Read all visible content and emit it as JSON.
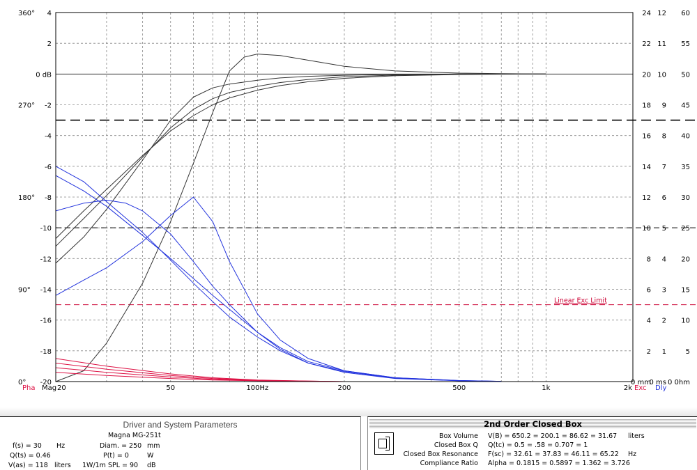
{
  "chart_data": {
    "type": "line",
    "xscale": "log",
    "xlim": [
      20,
      2000
    ],
    "ylim": [
      -20,
      4
    ],
    "x_ticks": [
      {
        "v": 20,
        "label": "20"
      },
      {
        "v": 50,
        "label": "50"
      },
      {
        "v": 100,
        "label": "100Hz"
      },
      {
        "v": 200,
        "label": "200"
      },
      {
        "v": 500,
        "label": "500"
      },
      {
        "v": 1000,
        "label": "1k"
      },
      {
        "v": 2000,
        "label": "2k"
      }
    ],
    "mag_ticks": [
      {
        "v": 4,
        "label": "4"
      },
      {
        "v": 2,
        "label": "2"
      },
      {
        "v": 0,
        "label": "0 dB"
      },
      {
        "v": -2,
        "label": "-2"
      },
      {
        "v": -4,
        "label": "-4"
      },
      {
        "v": -6,
        "label": "-6"
      },
      {
        "v": -8,
        "label": "-8"
      },
      {
        "v": -10,
        "label": "-10"
      },
      {
        "v": -12,
        "label": "-12"
      },
      {
        "v": -14,
        "label": "-14"
      },
      {
        "v": -16,
        "label": "-16"
      },
      {
        "v": -18,
        "label": "-18"
      },
      {
        "v": -20,
        "label": "-20"
      }
    ],
    "phase_ticks": [
      {
        "v": 4,
        "label": "360°"
      },
      {
        "v": -2,
        "label": "270°"
      },
      {
        "v": -8,
        "label": "180°"
      },
      {
        "v": -14,
        "label": "90°"
      },
      {
        "v": -20,
        "label": "0°"
      }
    ],
    "right_axes": [
      {
        "values": [
          "24",
          "22",
          "20",
          "18",
          "16",
          "14",
          "12",
          "10",
          "8",
          "6",
          "4",
          "2",
          "0 mm"
        ]
      },
      {
        "values": [
          "12",
          "11",
          "10",
          "9",
          "8",
          "7",
          "6",
          "5",
          "4",
          "3",
          "2",
          "1",
          "0 ms"
        ]
      },
      {
        "values": [
          "60",
          "55",
          "50",
          "45",
          "40",
          "35",
          "30",
          "25",
          "20",
          "15",
          "10",
          "5",
          "0 0hm"
        ]
      }
    ],
    "bottom_labels": {
      "pha": "Pha",
      "mag": "Mag",
      "exc": "Exc",
      "dly": "Dly"
    },
    "reference_lines": [
      {
        "y": -3,
        "style": "long-dash",
        "color": "#000000"
      },
      {
        "y": -10,
        "style": "dash",
        "color": "#000000"
      },
      {
        "y": -15,
        "style": "dash",
        "color": "#cc0033",
        "label": "Linear Exc Limit"
      }
    ],
    "series": [
      {
        "group": "magnitude",
        "color": "#333333",
        "x": [
          20,
          25,
          30,
          40,
          50,
          60,
          70,
          80,
          90,
          100,
          120,
          150,
          200,
          300,
          500,
          700,
          1000
        ],
        "y": [
          -21,
          -19.3,
          -17.5,
          -13.6,
          -9.6,
          -5.8,
          -2.5,
          0.2,
          1.1,
          1.3,
          1.2,
          0.9,
          0.5,
          0.2,
          0.06,
          0.03,
          0.0
        ]
      },
      {
        "group": "magnitude",
        "color": "#333333",
        "x": [
          20,
          25,
          30,
          40,
          50,
          60,
          70,
          80,
          100,
          120,
          150,
          200,
          300,
          500,
          700,
          1000
        ],
        "y": [
          -12.3,
          -10.6,
          -8.8,
          -5.6,
          -3.0,
          -1.5,
          -0.9,
          -0.65,
          -0.4,
          -0.25,
          -0.15,
          -0.08,
          -0.03,
          0,
          0,
          0
        ]
      },
      {
        "group": "magnitude",
        "color": "#333333",
        "x": [
          20,
          25,
          30,
          40,
          50,
          60,
          70,
          80,
          100,
          120,
          150,
          200,
          300,
          500,
          700,
          1000
        ],
        "y": [
          -11.2,
          -9.4,
          -7.9,
          -5.4,
          -3.5,
          -2.3,
          -1.6,
          -1.2,
          -0.8,
          -0.55,
          -0.35,
          -0.18,
          -0.07,
          -0.02,
          0,
          0
        ]
      },
      {
        "group": "magnitude",
        "color": "#333333",
        "x": [
          20,
          25,
          30,
          40,
          50,
          60,
          70,
          80,
          100,
          120,
          150,
          200,
          300,
          500,
          700,
          1000
        ],
        "y": [
          -10.7,
          -8.9,
          -7.5,
          -5.3,
          -3.7,
          -2.7,
          -2.0,
          -1.55,
          -1.05,
          -0.75,
          -0.5,
          -0.28,
          -0.11,
          -0.03,
          -0.01,
          0
        ]
      },
      {
        "group": "excursion",
        "color": "#2233dd",
        "x": [
          20,
          25,
          30,
          40,
          50,
          60,
          70,
          80,
          100,
          120,
          150,
          200,
          300,
          500,
          700
        ],
        "y": [
          -14.4,
          -13.4,
          -12.6,
          -10.9,
          -9.2,
          -8.0,
          -9.6,
          -12.2,
          -15.6,
          -17.3,
          -18.5,
          -19.3,
          -19.75,
          -19.93,
          -19.98
        ]
      },
      {
        "group": "excursion",
        "color": "#2233dd",
        "x": [
          20,
          25,
          30,
          35,
          40,
          50,
          60,
          70,
          80,
          100,
          120,
          150,
          200,
          300,
          500,
          700
        ],
        "y": [
          -8.9,
          -8.4,
          -8.2,
          -8.4,
          -8.9,
          -10.4,
          -12.2,
          -13.8,
          -15.0,
          -16.8,
          -17.9,
          -18.8,
          -19.4,
          -19.8,
          -19.95,
          -19.99
        ]
      },
      {
        "group": "excursion",
        "color": "#2233dd",
        "x": [
          20,
          25,
          30,
          40,
          50,
          60,
          70,
          80,
          100,
          120,
          150,
          200,
          300,
          500,
          700
        ],
        "y": [
          -6.6,
          -7.6,
          -8.6,
          -10.5,
          -12.0,
          -13.3,
          -14.4,
          -15.3,
          -16.8,
          -17.8,
          -18.7,
          -19.3,
          -19.75,
          -19.93,
          -19.98
        ]
      },
      {
        "group": "excursion",
        "color": "#2233dd",
        "x": [
          20,
          25,
          30,
          40,
          50,
          60,
          70,
          80,
          100,
          120,
          150,
          200,
          300,
          500,
          700
        ],
        "y": [
          -6.0,
          -7.0,
          -8.3,
          -10.3,
          -12.1,
          -13.6,
          -14.8,
          -15.8,
          -17.1,
          -18.0,
          -18.8,
          -19.35,
          -19.78,
          -19.94,
          -19.98
        ]
      },
      {
        "group": "delay",
        "color": "#dd1144",
        "x": [
          20,
          30,
          50,
          70,
          100,
          150,
          200
        ],
        "y": [
          -18.5,
          -19.0,
          -19.5,
          -19.75,
          -19.9,
          -19.97,
          -20
        ]
      },
      {
        "group": "delay",
        "color": "#dd1144",
        "x": [
          20,
          30,
          50,
          70,
          100,
          150,
          200
        ],
        "y": [
          -18.8,
          -19.2,
          -19.6,
          -19.8,
          -19.92,
          -19.97,
          -20
        ]
      },
      {
        "group": "delay",
        "color": "#dd1144",
        "x": [
          20,
          30,
          50,
          70,
          100,
          150,
          200
        ],
        "y": [
          -19.1,
          -19.4,
          -19.7,
          -19.85,
          -19.93,
          -19.98,
          -20
        ]
      },
      {
        "group": "delay",
        "color": "#dd1144",
        "x": [
          20,
          30,
          50,
          70,
          100,
          150,
          200
        ],
        "y": [
          -19.4,
          -19.6,
          -19.8,
          -19.9,
          -19.95,
          -19.99,
          -20
        ]
      }
    ]
  },
  "driver_panel": {
    "title": "Driver and System Parameters",
    "model": "Magna MG-251t",
    "rows": [
      {
        "k1": "f(s) = 30",
        "u1": "Hz",
        "k2": "Diam. = 250",
        "u2": "mm"
      },
      {
        "k1": "Q(ts) = 0.46",
        "u1": "",
        "k2": "P(t) = 0",
        "u2": "W"
      },
      {
        "k1": "V(as) = 118",
        "u1": "liters",
        "k2": "1W/1m SPL = 90",
        "u2": "dB"
      }
    ]
  },
  "box_panel": {
    "title": "2nd Order Closed Box",
    "rows": [
      {
        "label": "Box Volume",
        "values": "V(B) = 650.2   = 200.1   = 86.62   = 31.67",
        "unit": "liters"
      },
      {
        "label": "Closed Box Q",
        "values": "Q(tc) = 0.5   = .58   = 0.707   = 1",
        "unit": ""
      },
      {
        "label": "Closed Box Resonance",
        "values": "F(sc) = 32.61   = 37.83   = 46.11   = 65.22",
        "unit": "Hz"
      },
      {
        "label": "Compliance Ratio",
        "values": "Alpha = 0.1815   = 0.5897   = 1.362   = 3.726",
        "unit": ""
      }
    ]
  }
}
